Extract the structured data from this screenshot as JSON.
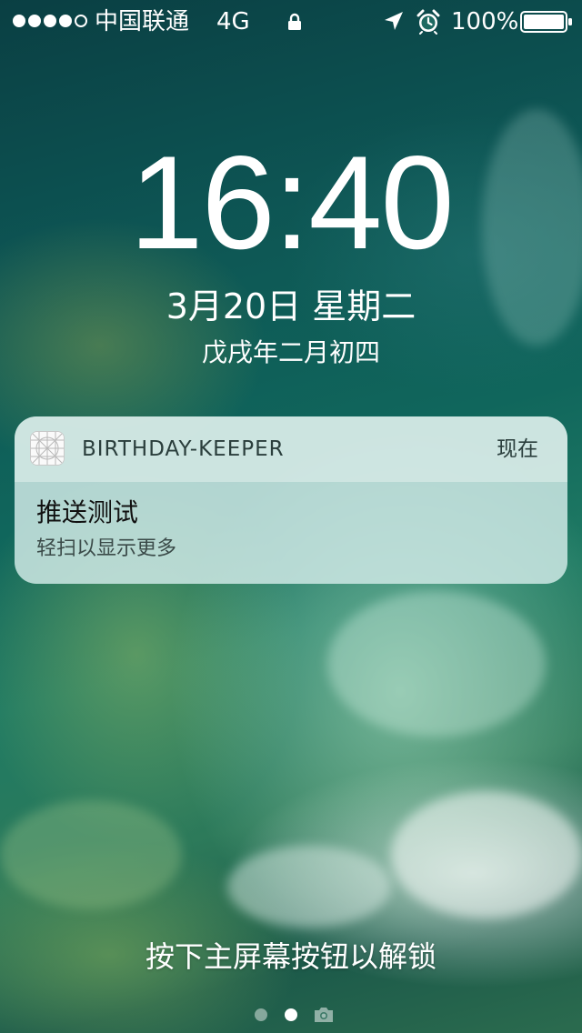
{
  "status_bar": {
    "signal_bars_filled": 4,
    "signal_bars_total": 5,
    "carrier": "中国联通",
    "network": "4G",
    "lock_icon": "lock-icon",
    "location_icon": "location-arrow-icon",
    "alarm_icon": "alarm-clock-icon",
    "battery_percent": "100%",
    "battery_level": 1.0
  },
  "lock_screen": {
    "time": "16:40",
    "date": "3月20日 星期二",
    "lunar_date": "戊戌年二月初四"
  },
  "notification": {
    "app_name": "BIRTHDAY-KEEPER",
    "time": "现在",
    "title": "推送测试",
    "body": "轻扫以显示更多"
  },
  "bottom": {
    "unlock_hint": "按下主屏幕按钮以解锁",
    "pages": [
      "widgets",
      "lock",
      "camera"
    ],
    "current_page": 1
  },
  "colors": {
    "notification_bg": "#cde8e4",
    "wallpaper_deep": "#0d5453",
    "text": "#ffffff"
  }
}
